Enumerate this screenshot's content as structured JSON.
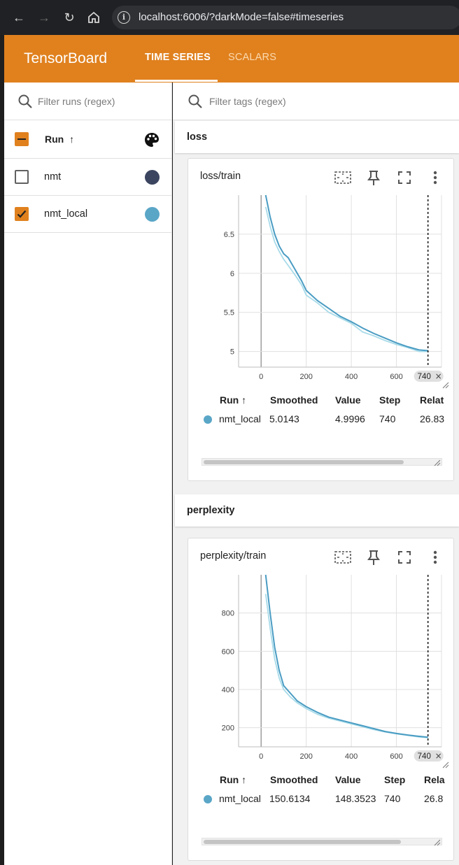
{
  "browser": {
    "url": "localhost:6006/?darkMode=false#timeseries",
    "info_icon": "i"
  },
  "header": {
    "brand": "TensorBoard",
    "tabs": [
      {
        "label": "TIME SERIES",
        "active": true
      },
      {
        "label": "SCALARS",
        "active": false
      }
    ],
    "color": "#e0811e"
  },
  "sidebar": {
    "filter_placeholder": "Filter runs (regex)",
    "run_header": "Run",
    "sort_arrow": "↑",
    "runs": [
      {
        "name": "nmt",
        "checked": false,
        "color": "#3b4560"
      },
      {
        "name": "nmt_local",
        "checked": true,
        "color": "#5aa6c7"
      }
    ]
  },
  "main": {
    "filter_placeholder": "Filter tags (regex)",
    "groups": [
      {
        "title": "loss",
        "card": {
          "title": "loss/train",
          "step_chip": "740",
          "table": {
            "headers": [
              "Run ↑",
              "Smoothed",
              "Value",
              "Step",
              "Relat"
            ],
            "row": {
              "run": "nmt_local",
              "smoothed": "5.0143",
              "value": "4.9996",
              "step": "740",
              "relative": "26.83"
            }
          }
        }
      },
      {
        "title": "perplexity",
        "card": {
          "title": "perplexity/train",
          "step_chip": "740",
          "table": {
            "headers": [
              "Run ↑",
              "Smoothed",
              "Value",
              "Step",
              "Rela"
            ],
            "row": {
              "run": "nmt_local",
              "smoothed": "150.6134",
              "value": "148.3523",
              "step": "740",
              "relative": "26.8"
            }
          }
        }
      }
    ]
  },
  "chart_data": [
    {
      "type": "line",
      "title": "loss/train",
      "xlabel": "",
      "ylabel": "",
      "x_ticks": [
        0,
        200,
        400,
        600
      ],
      "y_ticks": [
        "5",
        "5.5",
        "6",
        "6.5"
      ],
      "xlim": [
        -100,
        800
      ],
      "ylim": [
        4.8,
        7.0
      ],
      "grid": true,
      "step_marker": 740,
      "series": [
        {
          "name": "nmt_local",
          "kind": "smoothed",
          "color": "#4a9cc3",
          "x": [
            20,
            40,
            60,
            80,
            100,
            120,
            150,
            180,
            200,
            250,
            300,
            350,
            400,
            450,
            500,
            550,
            600,
            650,
            700,
            740
          ],
          "y": [
            7.0,
            6.72,
            6.5,
            6.35,
            6.25,
            6.2,
            6.05,
            5.9,
            5.78,
            5.65,
            5.55,
            5.45,
            5.38,
            5.3,
            5.23,
            5.17,
            5.11,
            5.06,
            5.02,
            5.01
          ]
        },
        {
          "name": "nmt_local",
          "kind": "value",
          "color": "#a8dbe9",
          "x": [
            20,
            40,
            60,
            80,
            100,
            120,
            150,
            180,
            200,
            250,
            300,
            350,
            400,
            450,
            500,
            550,
            600,
            650,
            700,
            740
          ],
          "y": [
            6.85,
            6.6,
            6.4,
            6.28,
            6.18,
            6.1,
            5.98,
            5.85,
            5.72,
            5.62,
            5.5,
            5.43,
            5.36,
            5.25,
            5.2,
            5.14,
            5.09,
            5.05,
            5.0,
            5.0
          ]
        }
      ]
    },
    {
      "type": "line",
      "title": "perplexity/train",
      "xlabel": "",
      "ylabel": "",
      "x_ticks": [
        0,
        200,
        400,
        600
      ],
      "y_ticks": [
        "200",
        "400",
        "600",
        "800"
      ],
      "xlim": [
        -100,
        800
      ],
      "ylim": [
        100,
        1000
      ],
      "grid": true,
      "step_marker": 740,
      "series": [
        {
          "name": "nmt_local",
          "kind": "smoothed",
          "color": "#4a9cc3",
          "x": [
            20,
            40,
            60,
            80,
            100,
            130,
            160,
            200,
            250,
            300,
            350,
            400,
            450,
            500,
            550,
            600,
            650,
            700,
            740
          ],
          "y": [
            1000,
            800,
            620,
            500,
            420,
            380,
            340,
            310,
            280,
            255,
            240,
            225,
            210,
            195,
            180,
            170,
            162,
            155,
            150
          ]
        },
        {
          "name": "nmt_local",
          "kind": "value",
          "color": "#a8dbe9",
          "x": [
            20,
            40,
            60,
            80,
            100,
            130,
            160,
            200,
            250,
            300,
            350,
            400,
            450,
            500,
            550,
            600,
            650,
            700,
            740
          ],
          "y": [
            900,
            720,
            560,
            460,
            400,
            360,
            330,
            300,
            270,
            250,
            235,
            220,
            205,
            190,
            178,
            168,
            160,
            152,
            148
          ]
        }
      ]
    }
  ]
}
